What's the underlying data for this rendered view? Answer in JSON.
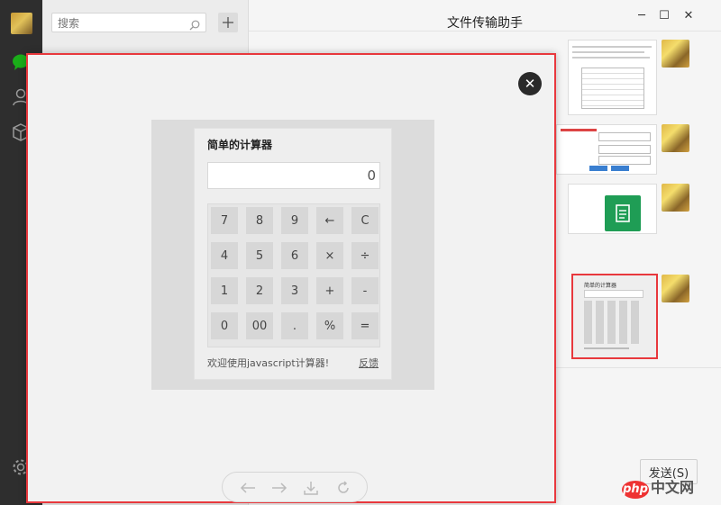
{
  "search": {
    "placeholder": "搜索"
  },
  "chat": {
    "title": "文件传输助手",
    "send_label": "发送(S)"
  },
  "window": {
    "min": "─",
    "max": "☐",
    "close": "✕"
  },
  "preview_thumb": {
    "title": "简单的计算器"
  },
  "calculator": {
    "title": "简单的计算器",
    "display": "0",
    "keys": [
      [
        "7",
        "8",
        "9",
        "←",
        "C"
      ],
      [
        "4",
        "5",
        "6",
        "×",
        "÷"
      ],
      [
        "1",
        "2",
        "3",
        "+",
        "-"
      ],
      [
        "0",
        "00",
        ".",
        "%",
        "="
      ]
    ],
    "footer": "欢迎使用javascript计算器!",
    "feedback": "反馈"
  },
  "viewer": {
    "close": "✕"
  },
  "watermark": {
    "brand": "php",
    "site": "中文网"
  },
  "colors": {
    "highlight_border": "#e8383d",
    "wechat_green": "#1aad19"
  }
}
